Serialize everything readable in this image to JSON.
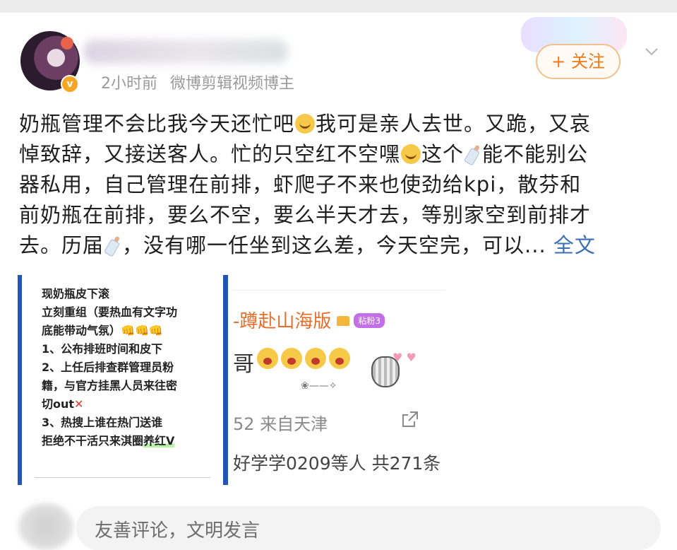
{
  "post": {
    "time": "2小时前",
    "source": "微博剪辑视频博主",
    "follow_label": "+ 关注",
    "verified_badge": "v",
    "text_lines": [
      "奶瓶管理不会比我今天还忙吧",
      "我可是亲人去世。又跪，又哀",
      "悼致辞，又接送客人。忙的只空红不空嘿",
      "这个",
      "能不能别公",
      "器私用，自己管理在前排，虾爬子不来也使劲给kpi，散芬和",
      "前奶瓶在前排，要么不空，要么半天才去，等别家空到前排才",
      "去。历届",
      "，没有哪一任坐到这么差，今天空完，可以..."
    ],
    "more_label": "全文"
  },
  "image_left": {
    "lines": [
      "现奶瓶皮下滚",
      "立刻重组（要热血有文字功",
      "底能带动气氛）",
      "1、公布排班时间和皮下",
      "2、上任后排查群管理员粉",
      "籍，与官方挂黑人员来往密",
      "切out",
      "3、热搜上谁在热门送谁",
      "拒绝不干活只来淇圈",
      "养红V"
    ],
    "fist_emojis": "👊👊👊",
    "cross": "✕"
  },
  "image_right": {
    "title": "-蹲赴山海版",
    "level": "粘粉3",
    "name_tail": "哥",
    "source_prefix": "52",
    "source": "来自天津",
    "likes": "好学学0209等人 共271条",
    "wand": "❀——✧"
  },
  "comment_bar": {
    "placeholder": "友善评论，文明发言"
  },
  "colors": {
    "accent_orange": "#ee7a18",
    "link_blue": "#3c6fb4",
    "frame_blue": "#2355b5"
  },
  "icons": [
    "chevron-down-icon",
    "share-icon",
    "verified-icon",
    "sweat-smile-emoji",
    "baby-bottle-emoji"
  ]
}
